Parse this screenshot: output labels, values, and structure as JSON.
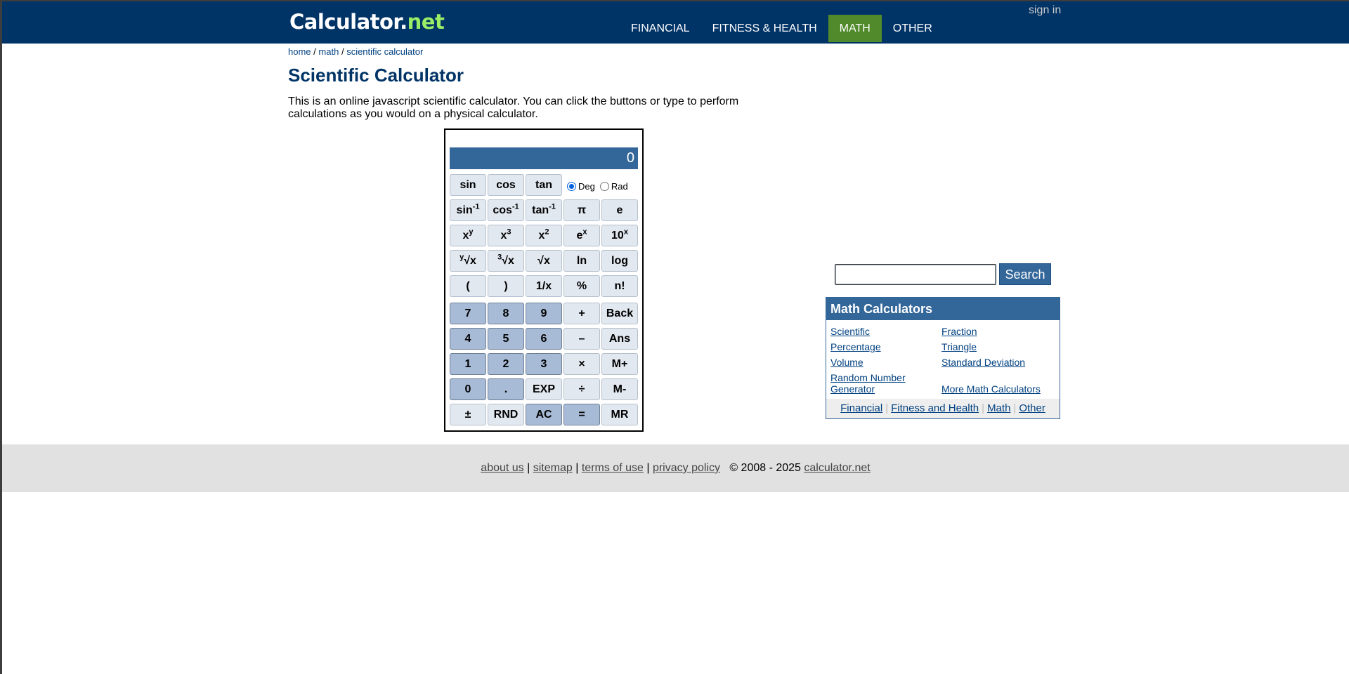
{
  "header": {
    "logo_main": "Calculator",
    "logo_dot": ".",
    "logo_net": "net",
    "sign_in": "sign in",
    "nav": [
      "FINANCIAL",
      "FITNESS & HEALTH",
      "MATH",
      "OTHER"
    ],
    "active_nav": "MATH",
    "colors": {
      "bar": "#003366",
      "active": "#518a2a",
      "net": "#99ee66"
    }
  },
  "breadcrumb": {
    "home": "home",
    "math": "math",
    "current": "scientific calculator",
    "sep": "/"
  },
  "page": {
    "title": "Scientific Calculator",
    "intro": "This is an online javascript scientific calculator. You can click the buttons or type to perform calculations as you would on a physical calculator."
  },
  "calculator": {
    "display": "0",
    "angle_mode": {
      "deg": "Deg",
      "rad": "Rad",
      "selected": "Deg"
    },
    "keys": {
      "sin": "sin",
      "cos": "cos",
      "tan": "tan",
      "asin": "sin",
      "acos": "cos",
      "atan": "tan",
      "inv_sup": "-1",
      "pi": "π",
      "e": "e",
      "x_base": "x",
      "y_sup": "y",
      "three_sup": "3",
      "two_sup": "2",
      "ex_base": "e",
      "ten_base": "10",
      "root_char": "√x",
      "sqrt": "√x",
      "ln": "ln",
      "log": "log",
      "lparen": "(",
      "rparen": ")",
      "reciprocal": "1/x",
      "percent": "%",
      "factorial": "n!",
      "seven": "7",
      "eight": "8",
      "nine": "9",
      "plus": "+",
      "back": "Back",
      "four": "4",
      "five": "5",
      "six": "6",
      "minus": "–",
      "ans": "Ans",
      "one": "1",
      "two": "2",
      "three": "3",
      "times": "×",
      "mplus": "M+",
      "zero": "0",
      "dot": ".",
      "exp": "EXP",
      "divide": "÷",
      "mminus": "M-",
      "plusminus": "±",
      "rnd": "RND",
      "ac": "AC",
      "equals": "=",
      "mr": "MR"
    }
  },
  "search": {
    "button": "Search",
    "value": ""
  },
  "math_panel": {
    "title": "Math Calculators",
    "links": {
      "scientific": "Scientific",
      "fraction": "Fraction",
      "percentage": "Percentage",
      "triangle": "Triangle",
      "volume": "Volume",
      "std_dev": "Standard Deviation",
      "random_1": "Random Number",
      "random_2": "Generator",
      "more": "More Math Calculators"
    },
    "footer": [
      "Financial",
      "Fitness and Health",
      "Math",
      "Other"
    ],
    "footer_sep": "|"
  },
  "footer": {
    "about": "about us",
    "sitemap": "sitemap",
    "terms": "terms of use",
    "privacy": "privacy policy",
    "sep": "|",
    "copyright": "© 2008 - 2025",
    "site": "calculator.net"
  }
}
